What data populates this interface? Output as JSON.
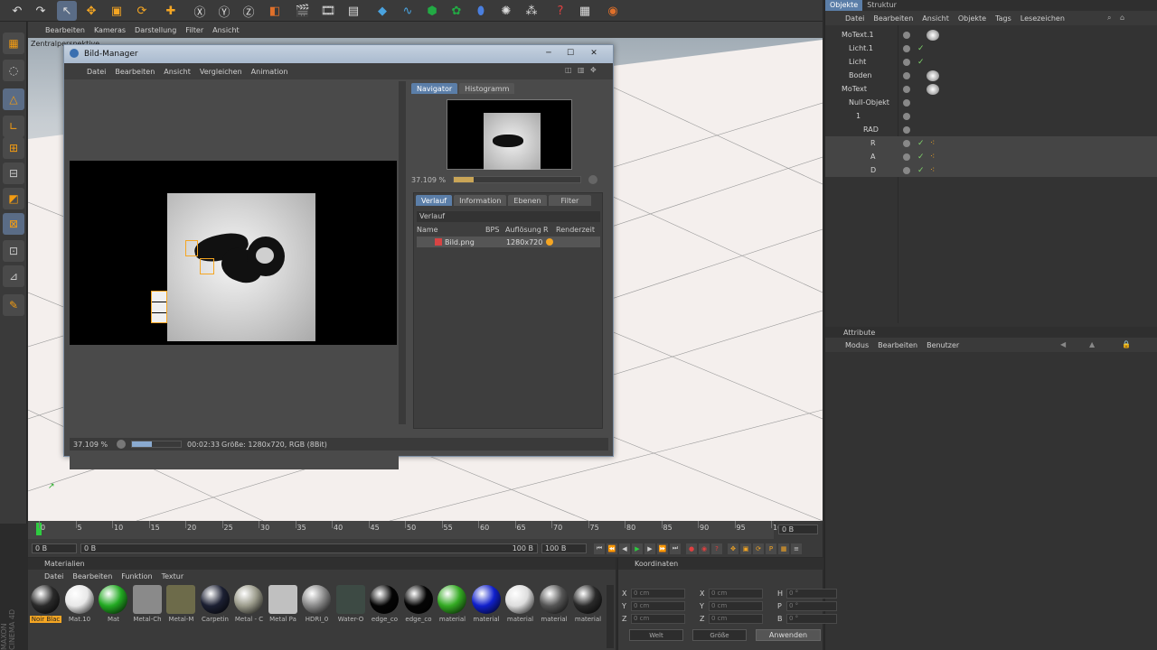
{
  "viewport": {
    "menu": [
      "Bearbeiten",
      "Kameras",
      "Darstellung",
      "Filter",
      "Ansicht"
    ],
    "label": "Zentralperspektive"
  },
  "bildmanager": {
    "title": "Bild-Manager",
    "menu": [
      "Datei",
      "Bearbeiten",
      "Ansicht",
      "Vergleichen",
      "Animation"
    ],
    "nav_tabs": [
      "Navigator",
      "Histogramm"
    ],
    "nav_zoom": "37.109 %",
    "history_tabs": [
      "Verlauf",
      "Information",
      "Ebenen",
      "Filter"
    ],
    "history_label": "Verlauf",
    "columns": [
      "Name",
      "BPS",
      "Auflösung",
      "R",
      "Renderzeit"
    ],
    "row": {
      "name": "Bild.png",
      "resolution": "1280x720"
    },
    "status_zoom": "37.109 %",
    "status_time": "00:02:33",
    "status_info": "Größe: 1280x720, RGB (8Bit)",
    "progress": 0.4
  },
  "objects": {
    "tabs": [
      "Objekte",
      "Struktur"
    ],
    "menu": [
      "Datei",
      "Bearbeiten",
      "Ansicht",
      "Objekte",
      "Tags",
      "Lesezeichen"
    ],
    "rows": [
      {
        "name": "MoText.1"
      },
      {
        "name": "Licht.1"
      },
      {
        "name": "Licht"
      },
      {
        "name": "Boden"
      },
      {
        "name": "MoText"
      },
      {
        "name": "Null-Objekt"
      },
      {
        "name": "1"
      },
      {
        "name": "RAD"
      },
      {
        "name": "R"
      },
      {
        "name": "A"
      },
      {
        "name": "D"
      }
    ]
  },
  "attributes": {
    "title": "Attribute",
    "menu": [
      "Modus",
      "Bearbeiten",
      "Benutzer"
    ]
  },
  "timeline": {
    "ticks": [
      "0",
      "5",
      "10",
      "15",
      "20",
      "25",
      "30",
      "35",
      "40",
      "45",
      "50",
      "55",
      "60",
      "65",
      "70",
      "75",
      "80",
      "85",
      "90",
      "95",
      "100"
    ],
    "current": "0 B",
    "start": "0 B",
    "min": "0 B",
    "max": "100 B",
    "end": "100 B"
  },
  "materials": {
    "title": "Materialien",
    "menu": [
      "Datei",
      "Bearbeiten",
      "Funktion",
      "Textur"
    ],
    "items": [
      {
        "label": "Noir Blac",
        "color": "#2a2a2a"
      },
      {
        "label": "Mat.10",
        "color": "#e8e8e8"
      },
      {
        "label": "Mat",
        "color": "#22aa22"
      },
      {
        "label": "Metal-Ch",
        "color": "#8a8a8a"
      },
      {
        "label": "Metal-M",
        "color": "#6d6b4a"
      },
      {
        "label": "Carpetin",
        "color": "#1c2033"
      },
      {
        "label": "Metal - C",
        "color": "#9a9a8a"
      },
      {
        "label": "Metal Pa",
        "color": "#c0c0c0"
      },
      {
        "label": "HDRI_0",
        "color": "#888888"
      },
      {
        "label": "Water-O",
        "color": "#3d4a44"
      },
      {
        "label": "edge_co",
        "color": "#050505"
      },
      {
        "label": "edge_co",
        "color": "#050505"
      },
      {
        "label": "material",
        "color": "#33aa22"
      },
      {
        "label": "material",
        "color": "#1020cc"
      },
      {
        "label": "material",
        "color": "#dddddd"
      },
      {
        "label": "material",
        "color": "#555555"
      },
      {
        "label": "material",
        "color": "#2a2a2a"
      }
    ]
  },
  "coordinates": {
    "title": "Koordinaten",
    "rows": [
      {
        "a": "X",
        "av": "0 cm",
        "b": "X",
        "bv": "0 cm",
        "c": "H",
        "cv": "0 °"
      },
      {
        "a": "Y",
        "av": "0 cm",
        "b": "Y",
        "bv": "0 cm",
        "c": "P",
        "cv": "0 °"
      },
      {
        "a": "Z",
        "av": "0 cm",
        "b": "Z",
        "bv": "0 cm",
        "c": "B",
        "cv": "0 °"
      }
    ],
    "mode1": "Welt",
    "mode2": "Größe",
    "apply": "Anwenden"
  },
  "branding": "MAXON CINEMA 4D"
}
